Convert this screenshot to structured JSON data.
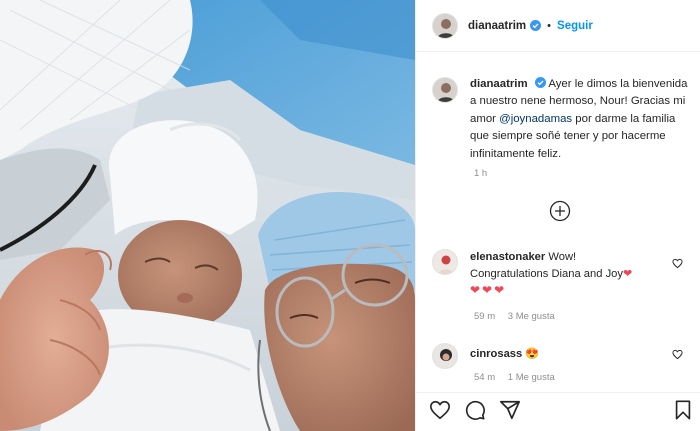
{
  "post": {
    "author": "dianaatrim",
    "follow_label": "Seguir",
    "dot": "•",
    "caption_text": "Ayer le dimos la bienvenida a nuestro nene hermoso, Nour! Gracias mi amor",
    "caption_mention": "@joynadamas",
    "caption_tail": "por darme la familia que siempre soñé tener y por hacerme infinitamente feliz.",
    "caption_time": "1 h"
  },
  "comments": [
    {
      "author": "elenastonaker",
      "text_1": "Wow!",
      "text_2": "Congratulations Diana and Joy",
      "text_emoji": "❤",
      "hearts": "❤❤❤",
      "time": "59 m",
      "likes": "3 Me gusta"
    },
    {
      "author": "cinrosass",
      "text_emoji": "😍",
      "time": "54 m",
      "likes": "1 Me gusta"
    }
  ],
  "icons": [
    "verified-badge-icon",
    "add-circle-icon",
    "heart-icon",
    "comment-icon",
    "share-icon",
    "save-icon"
  ],
  "colors": {
    "link": "#0095f6",
    "mention": "#00376b",
    "meta": "#8e8e8e",
    "heart": "#ed4956",
    "text": "#262626"
  }
}
